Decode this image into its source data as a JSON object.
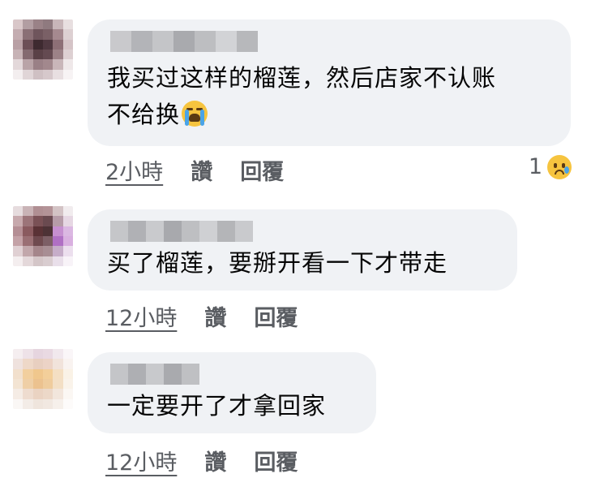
{
  "comments": [
    {
      "author": "",
      "text_line1": "我买过这样的榴莲，然后店家不认账",
      "text_line2": "不给换",
      "emoji": "loudly-crying-face-icon",
      "time": "2小時",
      "like_label": "讚",
      "reply_label": "回覆",
      "reaction_count": "1",
      "reaction_emoji": "crying-face-icon"
    },
    {
      "author": "",
      "text_line1": "买了榴莲，要掰开看一下才带走",
      "time": "12小時",
      "like_label": "讚",
      "reply_label": "回覆"
    },
    {
      "author": "",
      "text_line1": "一定要开了才拿回家",
      "time": "12小時",
      "like_label": "讚",
      "reply_label": "回覆"
    }
  ],
  "colors": {
    "bubble": "#f0f2f5",
    "text": "#050505",
    "meta": "#5a5d62"
  }
}
